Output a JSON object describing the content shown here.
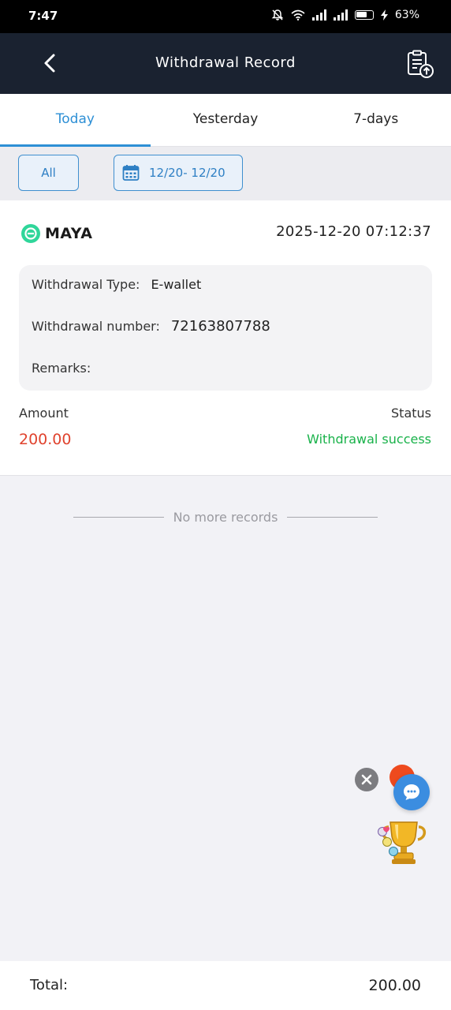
{
  "status_bar": {
    "time": "7:47",
    "battery": "63%",
    "icons": [
      "bell-off-icon",
      "wifi-icon",
      "signal-icon",
      "signal-icon",
      "battery-icon",
      "charging-icon"
    ]
  },
  "header": {
    "title": "Withdrawal Record",
    "back_icon": "chevron-left-icon",
    "right_icon": "clipboard-upload-icon"
  },
  "tabs": [
    {
      "label": "Today",
      "active": true
    },
    {
      "label": "Yesterday",
      "active": false
    },
    {
      "label": "7-days",
      "active": false
    }
  ],
  "filters": {
    "all_label": "All",
    "date_range": "12/20- 12/20",
    "date_icon": "calendar-icon"
  },
  "record": {
    "brand": "MAYA",
    "datetime": "2025-12-20  07:12:37",
    "type_label": "Withdrawal Type:",
    "type_value": "E-wallet",
    "number_label": "Withdrawal number:",
    "number_value": "72163807788",
    "remarks_label": "Remarks:",
    "remarks_value": "",
    "amount_label": "Amount",
    "amount_value": "200.00",
    "status_label": "Status",
    "status_value": "Withdrawal success"
  },
  "list_end": "No more records",
  "footer": {
    "total_label": "Total:",
    "total_value": "200.00"
  },
  "colors": {
    "accent": "#2d8fd5",
    "header_bg": "#1a2230",
    "amount": "#e0432e",
    "success": "#19b24a"
  }
}
